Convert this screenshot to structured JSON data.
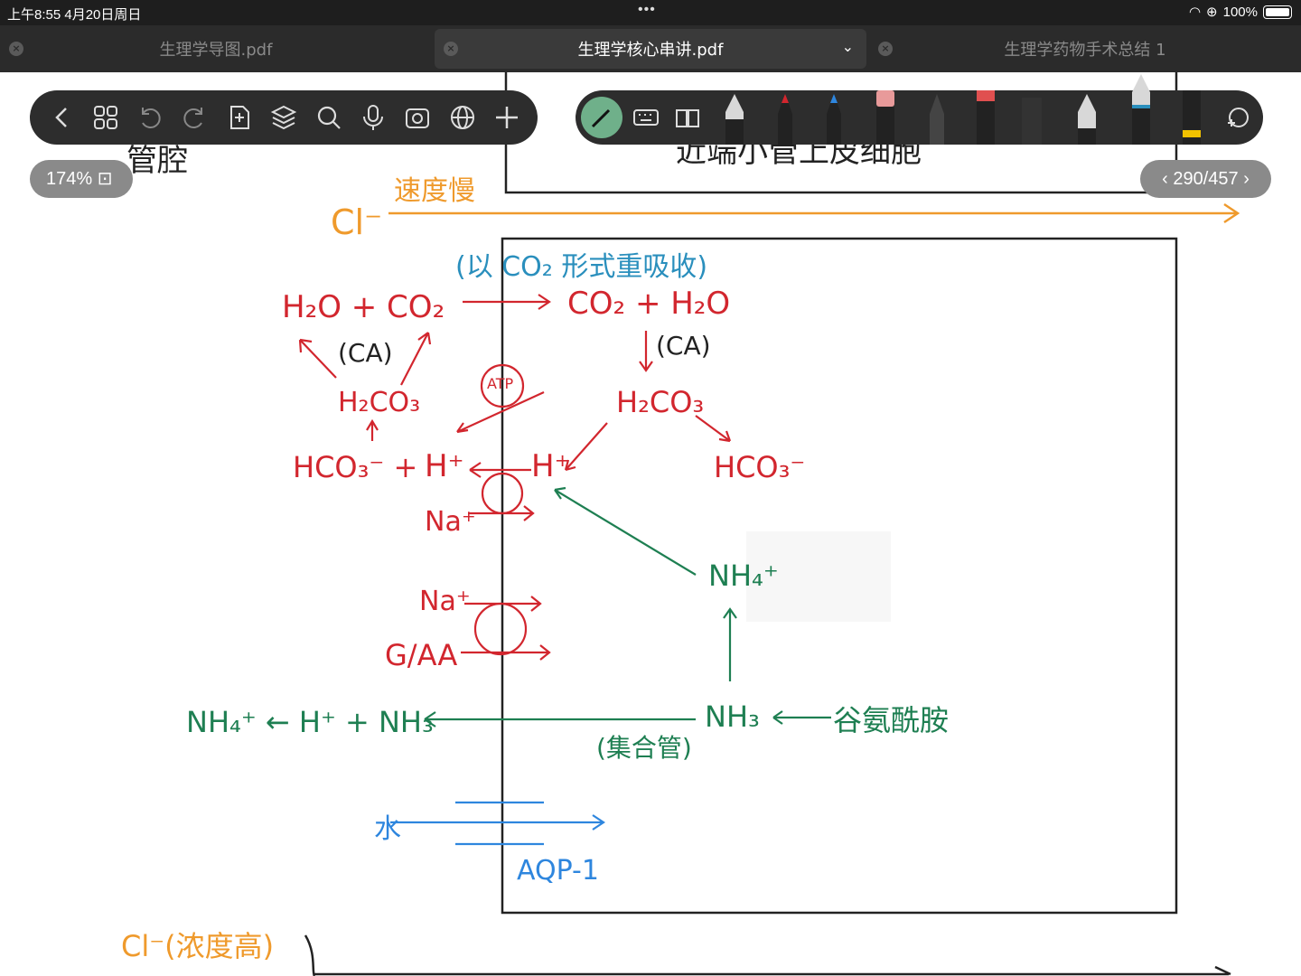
{
  "status": {
    "time": "上午8:55   4月20日周日",
    "battery": "100%"
  },
  "tabs": [
    {
      "label": "生理学导图.pdf",
      "active": false
    },
    {
      "label": "生理学核心串讲.pdf",
      "active": true
    },
    {
      "label": "生理学药物手术总结 1",
      "active": false
    }
  ],
  "zoom": "174%",
  "pager": "290/457",
  "notes": {
    "cl_top": "Cl⁻",
    "slow": "速度慢",
    "co2_note": "(以 CO₂ 形式重吸收)",
    "left_eq": "H₂O  +  CO₂",
    "right_eq": "CO₂  +  H₂O",
    "ca_left": "(CA)",
    "ca_right": "(CA)",
    "h2co3_left": "H₂CO₃",
    "h2co3_right": "H₂CO₃",
    "hco3_left": "HCO₃⁻  +",
    "h_left": "H⁺",
    "h_mid": "H⁺",
    "hco3_right": "HCO₃⁻",
    "atp": "ATP",
    "na1": "Na⁺",
    "na2": "Na⁺",
    "gaa": "G/AA",
    "nh4_right": "NH₄⁺",
    "nh3_right": "NH₃",
    "glutamine": "谷氨酰胺",
    "nh4_left": "NH₄⁺ ← H⁺ + NH₃",
    "collect": "(集合管)",
    "water": "水",
    "aqp": "AQP-1",
    "cl_bottom": "Cl⁻(浓度高)",
    "top_partial_1": "管腔",
    "top_partial_2": "近端小管上皮细胞"
  }
}
